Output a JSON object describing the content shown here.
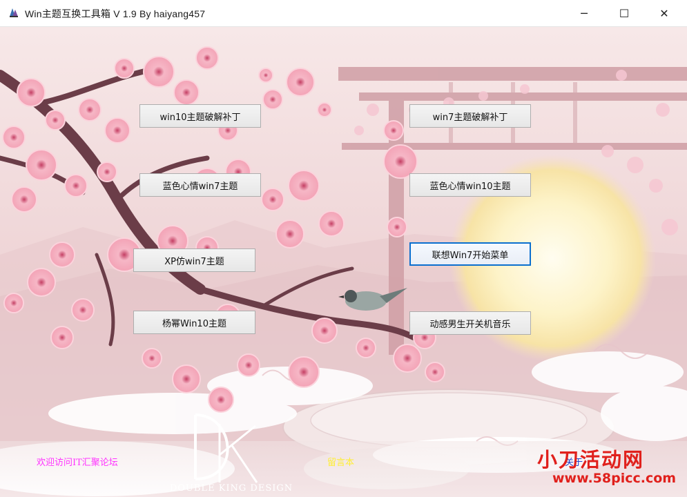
{
  "window": {
    "title": "Win主题互换工具箱 V 1.9  By haiyang457",
    "controls": {
      "minimize": "─",
      "maximize": "☐",
      "close": "✕"
    }
  },
  "buttons": {
    "win10_patch": "win10主题破解补丁",
    "win7_patch": "win7主题破解补丁",
    "blue_win7": "蓝色心情win7主题",
    "blue_win10": "蓝色心情win10主题",
    "xp_win7": "XP仿win7主题",
    "lenovo_menu": "联想Win7开始菜单",
    "yangmi_win10": "杨幂Win10主题",
    "boot_music": "动感男生开关机音乐"
  },
  "logo": {
    "letters": "DK",
    "caption": "DOUBLE KING DESIGN"
  },
  "links": {
    "visit": "欢迎访问IT汇聚论坛",
    "guestbook": "留言本",
    "about": "关于"
  },
  "watermark": {
    "line1": "小刀活动网",
    "line2": "www.58picc.com"
  },
  "colors": {
    "focus_border": "#0a6fcf",
    "link_pink": "#ff33ff",
    "link_yellow": "#ffee33",
    "watermark_red": "#e0201c"
  }
}
